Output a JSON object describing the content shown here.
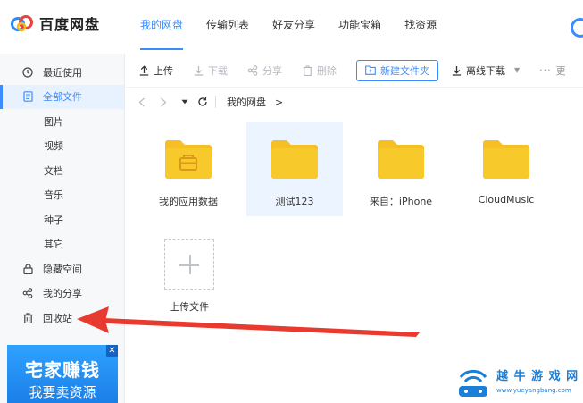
{
  "app": {
    "name": "百度网盘"
  },
  "nav": {
    "tabs": [
      {
        "label": "我的网盘",
        "active": true
      },
      {
        "label": "传输列表",
        "active": false
      },
      {
        "label": "好友分享",
        "active": false
      },
      {
        "label": "功能宝箱",
        "active": false
      },
      {
        "label": "找资源",
        "active": false
      }
    ]
  },
  "sidebar": {
    "items": [
      {
        "label": "最近使用",
        "icon": "clock-icon"
      },
      {
        "label": "全部文件",
        "icon": "document-icon",
        "active": true
      },
      {
        "label": "图片"
      },
      {
        "label": "视频"
      },
      {
        "label": "文档"
      },
      {
        "label": "音乐"
      },
      {
        "label": "种子"
      },
      {
        "label": "其它"
      },
      {
        "label": "隐藏空间",
        "icon": "lock-icon"
      },
      {
        "label": "我的分享",
        "icon": "share-icon"
      },
      {
        "label": "回收站",
        "icon": "trash-icon"
      }
    ]
  },
  "ad": {
    "line1": "宅家赚钱",
    "line2": "我要卖资源",
    "close": "✕"
  },
  "toolbar": {
    "upload": "上传",
    "download": "下载",
    "share": "分享",
    "delete": "删除",
    "new_folder": "新建文件夹",
    "offline_download": "离线下载",
    "more": "更"
  },
  "path": {
    "crumbs": [
      "我的网盘"
    ],
    "separator": ">"
  },
  "files": [
    {
      "name": "我的应用数据",
      "type": "app-data-folder",
      "selected": false
    },
    {
      "name": "测试123",
      "type": "folder",
      "selected": true
    },
    {
      "name": "来自：iPhone",
      "type": "folder",
      "selected": false
    },
    {
      "name": "CloudMusic",
      "type": "folder",
      "selected": false
    }
  ],
  "upload_tile": {
    "label": "上传文件"
  },
  "watermark": {
    "text": "越 牛 游 戏 网",
    "url": "www.yueyangbang.com"
  },
  "colors": {
    "accent": "#3b8cff",
    "folder": "#f8c92b",
    "arrow": "#e83a2e"
  }
}
